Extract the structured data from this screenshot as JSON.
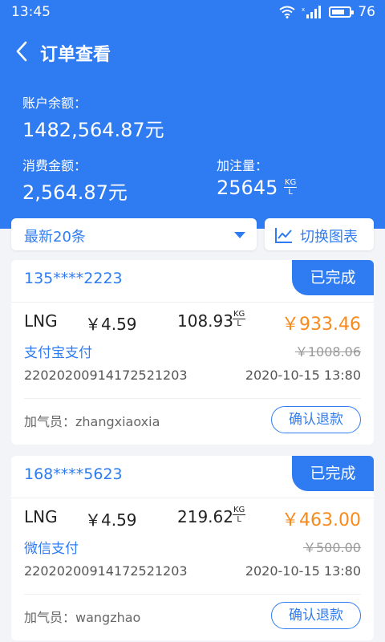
{
  "statusbar": {
    "time": "13:45",
    "battery": "76",
    "battery_level": 0.76
  },
  "nav": {
    "title": "订单查看"
  },
  "summary": {
    "balance_label": "账户余额：",
    "balance_value": "1482,564.87元",
    "spend_label": "消费金额：",
    "spend_value": "2,564.87元",
    "volume_label": "加注量：",
    "volume_value": "25645",
    "volume_unit_top": "KG",
    "volume_unit_bottom": "L"
  },
  "filter": {
    "selected": "最新20条"
  },
  "chart_toggle": {
    "label": "切换图表"
  },
  "orders": [
    {
      "phone": "135****2223",
      "status": "已完成",
      "fuel": "LNG",
      "unit_price": "￥4.59",
      "quantity": "108.93",
      "unit_top": "KG",
      "unit_bottom": "L",
      "amount": "￥933.46",
      "payment": "支付宝支付",
      "original": "￥1008.06",
      "order_no": "22020200914172521203",
      "datetime": "2020-10-15 13:80",
      "staff": "加气员：zhangxiaoxia",
      "refund": "确认退款"
    },
    {
      "phone": "168****5623",
      "status": "已完成",
      "fuel": "LNG",
      "unit_price": "￥4.59",
      "quantity": "219.62",
      "unit_top": "KG",
      "unit_bottom": "L",
      "amount": "￥463.00",
      "payment": "微信支付",
      "original": "￥500.00",
      "order_no": "22020200914172521203",
      "datetime": "2020-10-15 13:80",
      "staff": "加气员：wangzhao",
      "refund": "确认退款"
    }
  ],
  "colors": {
    "primary": "#2f7cf2",
    "amount": "#f78a1d",
    "background": "#f2f4f7"
  }
}
